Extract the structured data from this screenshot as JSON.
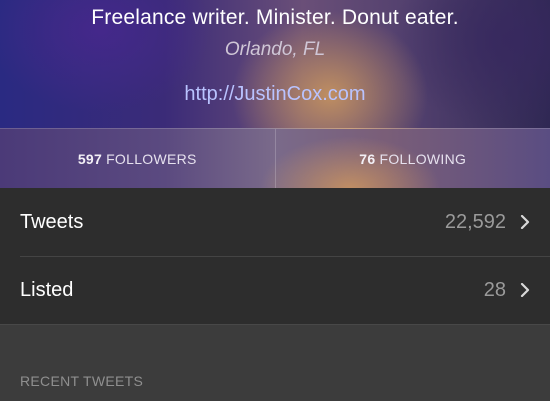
{
  "profile": {
    "bio": "Freelance writer. Minister. Donut eater.",
    "location": "Orlando, FL",
    "url": "http://JustinCox.com"
  },
  "stats": {
    "followers_count": "597",
    "followers_label": "FOLLOWERS",
    "following_count": "76",
    "following_label": "FOLLOWING"
  },
  "rows": [
    {
      "label": "Tweets",
      "value": "22,592",
      "icon": "chevron-right-icon"
    },
    {
      "label": "Listed",
      "value": "28",
      "icon": "chevron-right-icon"
    }
  ],
  "section": {
    "title": "RECENT TWEETS"
  },
  "colors": {
    "link": "#b9c3ff",
    "row_bg": "#2d2d2d",
    "section_bg": "#3c3c3c"
  }
}
